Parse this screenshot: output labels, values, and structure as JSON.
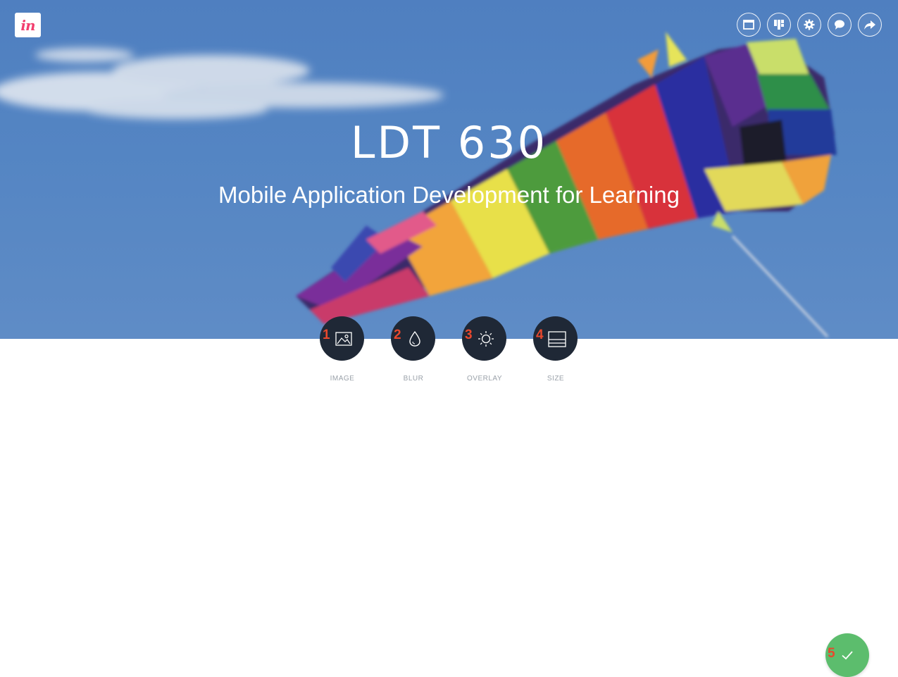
{
  "app": {
    "logo_text": "in"
  },
  "top_actions": [
    {
      "icon": "window-icon"
    },
    {
      "icon": "layout-grid-icon"
    },
    {
      "icon": "gear-icon"
    },
    {
      "icon": "comment-icon"
    },
    {
      "icon": "share-arrow-icon"
    }
  ],
  "hero": {
    "title": "LDT 630",
    "subtitle": "Mobile Application Development for Learning"
  },
  "tools": [
    {
      "number": "1",
      "label": "IMAGE",
      "icon": "image-icon"
    },
    {
      "number": "2",
      "label": "BLUR",
      "icon": "drop-icon"
    },
    {
      "number": "3",
      "label": "OVERLAY",
      "icon": "sun-icon"
    },
    {
      "number": "4",
      "label": "SIZE",
      "icon": "size-icon"
    }
  ],
  "confirm": {
    "number": "5",
    "icon": "check-icon"
  },
  "colors": {
    "sky": "#5485c3",
    "tool_bg": "#1f2836",
    "confirm": "#5cbd6d",
    "number_badge": "#e8482d",
    "logo_accent": "#f23e6e"
  }
}
